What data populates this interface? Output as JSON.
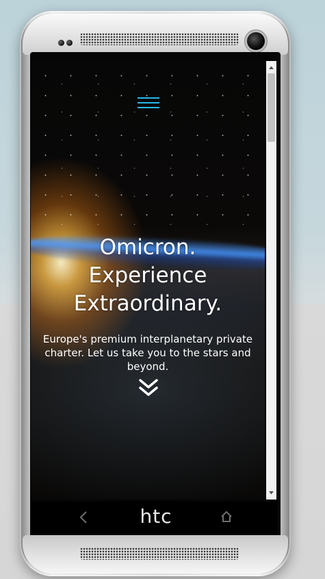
{
  "hero": {
    "title_lines": [
      "Omicron.",
      "Experience",
      "Extraordinary."
    ],
    "subtitle": "Europe's premium interplanetary private charter. Let us take you to the stars and beyond."
  },
  "device": {
    "brand": "htc"
  },
  "colors": {
    "accent": "#26b9ea",
    "text": "#ffffff",
    "scrollbar_track": "#f1f1f1",
    "scrollbar_thumb": "#c1c1c1"
  },
  "icons": {
    "menu": "hamburger-menu-icon",
    "scroll_down": "double-chevron-down-icon",
    "back": "back-icon",
    "home": "home-icon"
  }
}
